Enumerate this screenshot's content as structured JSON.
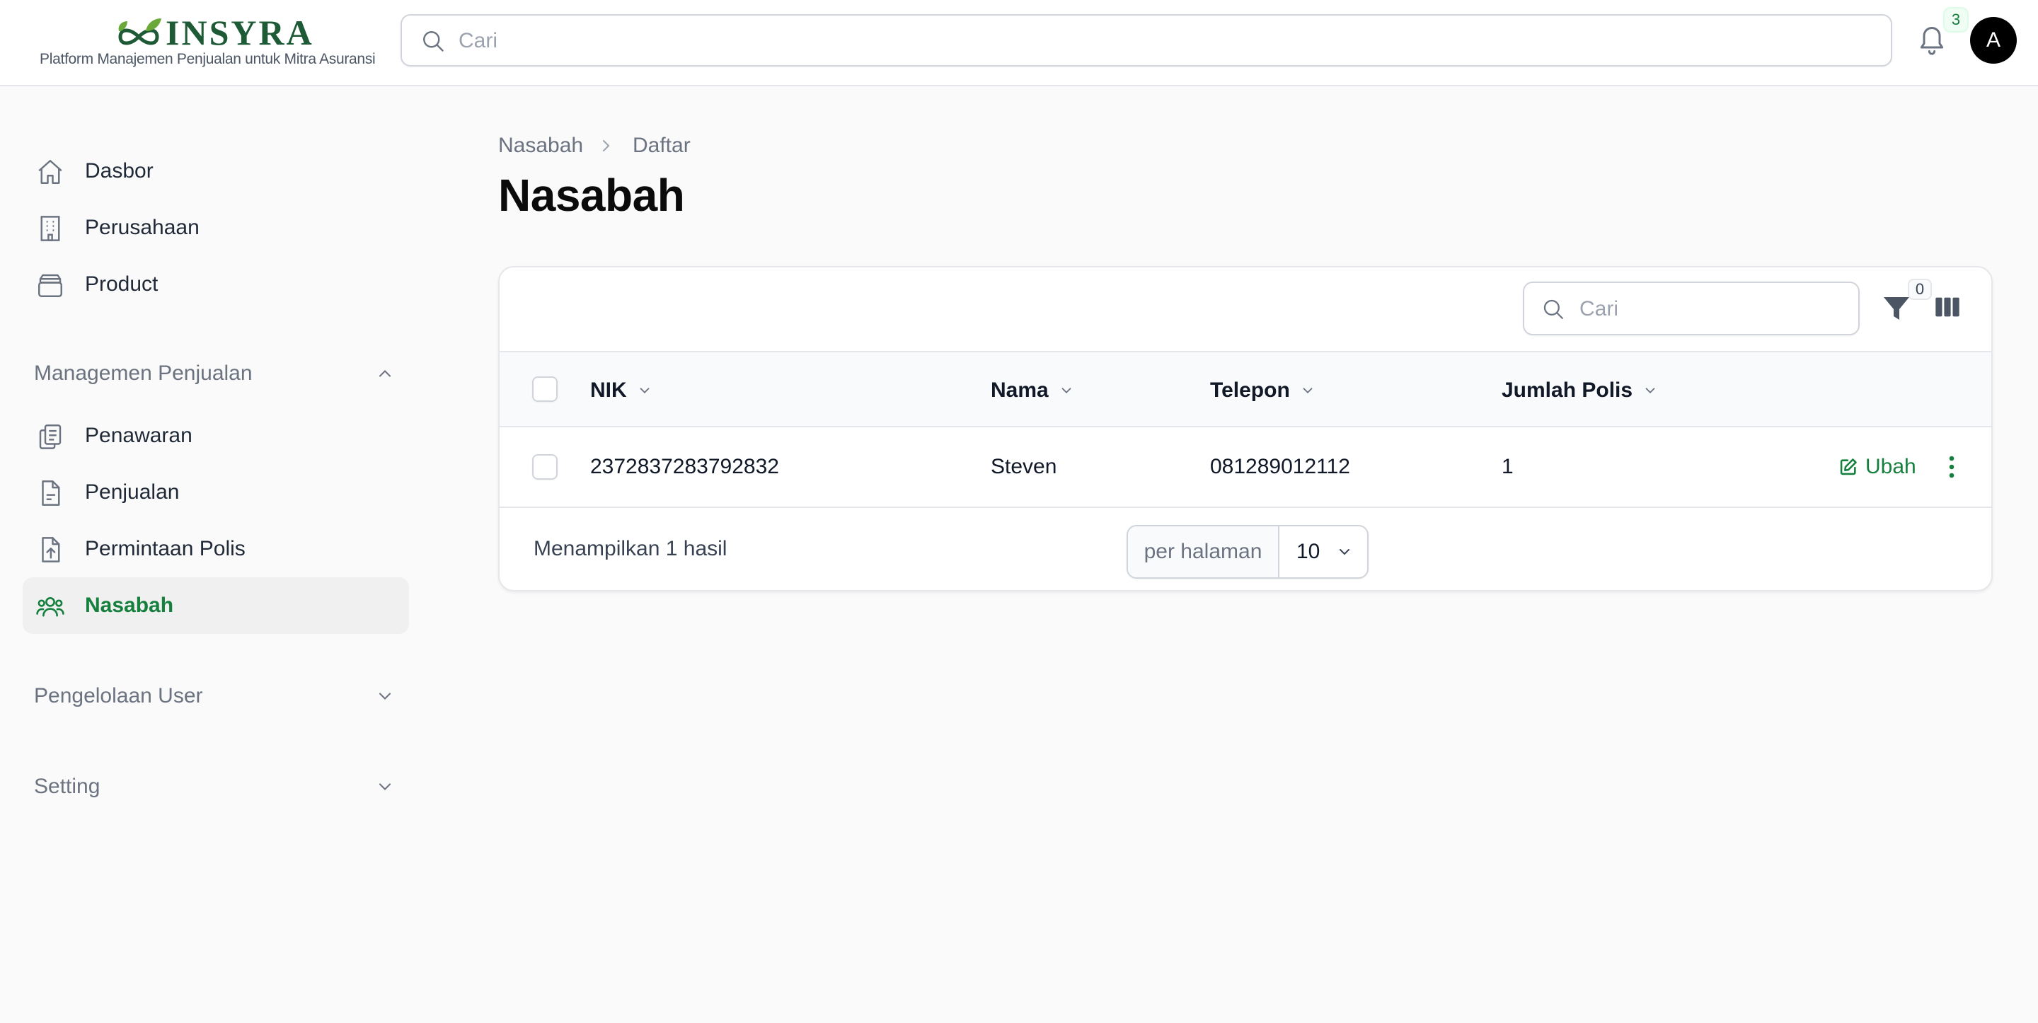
{
  "brand": {
    "name": "INSYRA",
    "tagline": "Platform Manajemen Penjualan untuk Mitra Asuransi",
    "color": "#1f5a36",
    "accent": "#6aa83a"
  },
  "topbar": {
    "search_placeholder": "Cari",
    "notifications_count": "3",
    "avatar_initial": "A"
  },
  "sidebar": {
    "items": [
      {
        "label": "Dasbor",
        "icon": "home-icon"
      },
      {
        "label": "Perusahaan",
        "icon": "building-icon"
      },
      {
        "label": "Product",
        "icon": "stack-icon"
      }
    ],
    "groups": [
      {
        "label": "Managemen Penjualan",
        "expanded": true,
        "items": [
          {
            "label": "Penawaran",
            "icon": "clipboard-icon"
          },
          {
            "label": "Penjualan",
            "icon": "document-icon"
          },
          {
            "label": "Permintaan Polis",
            "icon": "document-upload-icon"
          },
          {
            "label": "Nasabah",
            "icon": "users-icon",
            "active": true
          }
        ]
      },
      {
        "label": "Pengelolaan User",
        "expanded": false
      },
      {
        "label": "Setting",
        "expanded": false
      }
    ]
  },
  "breadcrumb": [
    "Nasabah",
    "Daftar"
  ],
  "page_title": "Nasabah",
  "table": {
    "search_placeholder": "Cari",
    "filter_count": "0",
    "columns": [
      "NIK",
      "Nama",
      "Telepon",
      "Jumlah Polis"
    ],
    "rows": [
      {
        "nik": "2372837283792832",
        "nama": "Steven",
        "telepon": "081289012112",
        "jumlah_polis": "1",
        "action": "Ubah"
      }
    ],
    "summary": "Menampilkan 1 hasil",
    "per_page_label": "per halaman",
    "per_page_value": "10"
  },
  "colors": {
    "accent_green": "#15803d",
    "active_bg": "#f0f0f0",
    "page_bg": "#fafafa"
  }
}
